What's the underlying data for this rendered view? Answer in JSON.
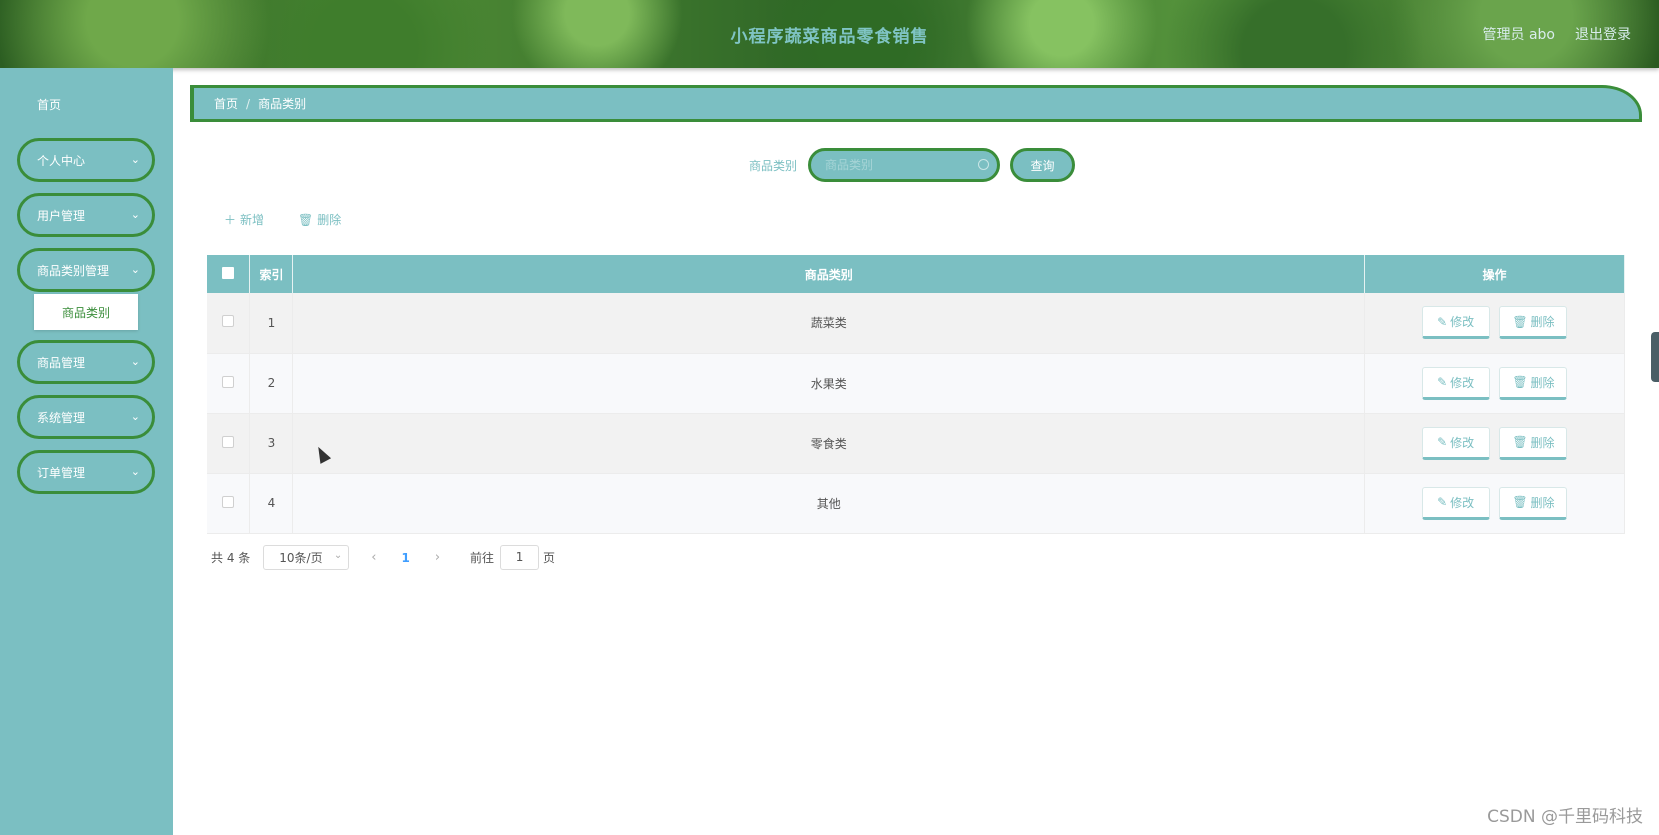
{
  "header": {
    "title": "小程序蔬菜商品零食销售",
    "user": "管理员 abo",
    "logout": "退出登录"
  },
  "sidebar": {
    "home": "首页",
    "items": [
      {
        "label": "个人中心"
      },
      {
        "label": "用户管理"
      },
      {
        "label": "商品类别管理"
      },
      {
        "label": "商品管理"
      },
      {
        "label": "系统管理"
      },
      {
        "label": "订单管理"
      }
    ],
    "submenu_active": "商品类别"
  },
  "breadcrumb": {
    "home": "首页",
    "separator": "/",
    "current": "商品类别"
  },
  "search": {
    "label": "商品类别",
    "placeholder": "商品类别",
    "button": "查询"
  },
  "toolbar": {
    "add": "新增",
    "delete": "删除"
  },
  "table": {
    "headers": [
      "索引",
      "商品类别",
      "操作"
    ],
    "rows": [
      {
        "index": "1",
        "category": "蔬菜类"
      },
      {
        "index": "2",
        "category": "水果类"
      },
      {
        "index": "3",
        "category": "零食类"
      },
      {
        "index": "4",
        "category": "其他"
      }
    ],
    "edit_label": "修改",
    "delete_label": "删除"
  },
  "pagination": {
    "total": "共 4 条",
    "page_size": "10条/页",
    "current_page": "1",
    "goto_label": "前往",
    "goto_value": "1",
    "page_unit": "页"
  },
  "watermark": "CSDN @千里码科技",
  "colors": {
    "accent": "#7bbfc2",
    "border_green": "#3a8d3a"
  }
}
